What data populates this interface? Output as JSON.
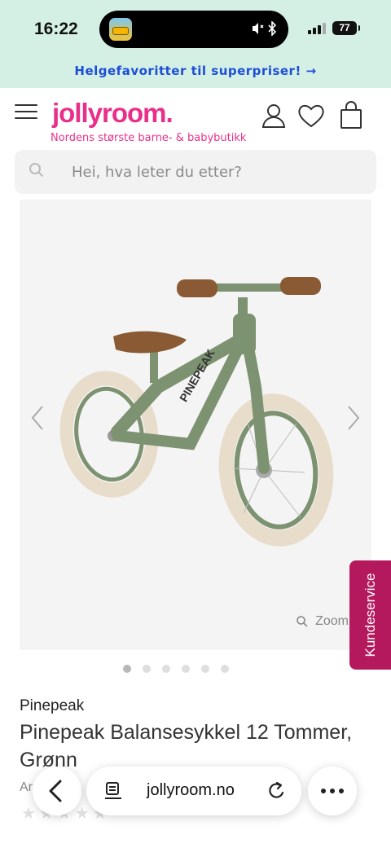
{
  "status_bar": {
    "time": "16:22",
    "battery": "77"
  },
  "promo_banner": {
    "text": "Helgefavoritter til superpriser! →"
  },
  "header": {
    "logo": "jollyroom.",
    "tagline": "Nordens største barne- & babybutikk"
  },
  "search": {
    "placeholder": "Hei, hva leter du etter?"
  },
  "gallery": {
    "zoom_label": "Zoom",
    "image_count": 6,
    "active_index": 0,
    "frame_logo_text": "PINEPEAK"
  },
  "side_tab": {
    "label": "Kundeservice"
  },
  "product": {
    "brand": "Pinepeak",
    "title": "Pinepeak Balansesykkel 12 Tommer, Grønn",
    "artnr_visible": "Ar",
    "rating_stars": 5
  },
  "safari": {
    "url": "jollyroom.no"
  },
  "colors": {
    "status_bg": "#d4f0e4",
    "brand_pink": "#e8308a",
    "promo_blue": "#1d4ed8",
    "kundeservice_bg": "#b5195d"
  }
}
